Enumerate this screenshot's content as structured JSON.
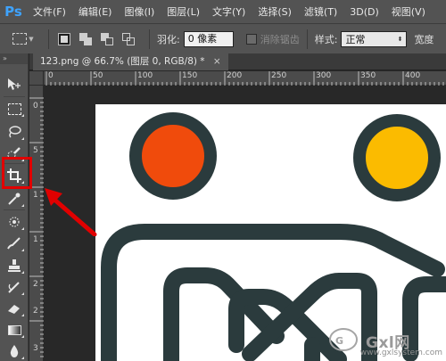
{
  "app": {
    "logo": "Ps",
    "menu": [
      "文件(F)",
      "编辑(E)",
      "图像(I)",
      "图层(L)",
      "文字(Y)",
      "选择(S)",
      "滤镜(T)",
      "3D(D)",
      "视图(V)"
    ]
  },
  "options": {
    "feather_label": "羽化:",
    "feather_value": "0 像素",
    "antialias_label": "消除锯齿",
    "style_label": "样式:",
    "style_value": "正常",
    "width_label_cut": "宽度"
  },
  "document": {
    "tab_title": "123.png @ 66.7% (图层 0, RGB/8) *",
    "tab_close": "×",
    "ruler_top_labels": [
      "0",
      "50",
      "100",
      "150",
      "200",
      "250",
      "300",
      "350",
      "400"
    ],
    "ruler_left_labels": [
      "0",
      "5",
      "1",
      "1",
      "2",
      "2",
      "3"
    ]
  },
  "tools": [
    "move-tool",
    "rectangular-marquee-tool",
    "lasso-tool",
    "quick-selection-tool",
    "crop-tool",
    "eyedropper-tool",
    "spot-healing-brush-tool",
    "brush-tool",
    "clone-stamp-tool",
    "history-brush-tool",
    "eraser-tool",
    "gradient-tool",
    "blur-tool"
  ],
  "active_tool": "crop-tool",
  "artwork": {
    "left_dot_color": "#f04b0c",
    "right_dot_color": "#fbbb00",
    "outline_color": "#2b3b3d"
  },
  "watermark": {
    "brand": "Gxl网",
    "url": "www.gxlsystem.com"
  },
  "annotation": {
    "color": "#e10000"
  }
}
